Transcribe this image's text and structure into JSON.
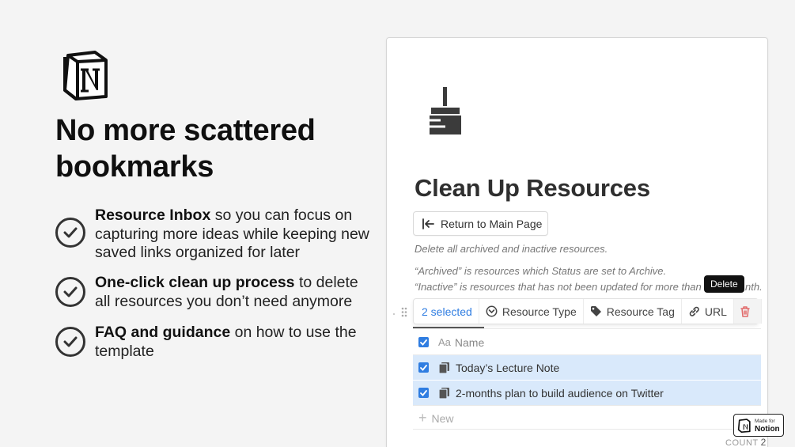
{
  "headline": "No more scattered bookmarks",
  "features": [
    {
      "bold": "Resource Inbox",
      "rest": " so you can focus on capturing more ideas while keeping new saved links organized for later"
    },
    {
      "bold": "One-click clean up process",
      "rest": " to delete all resources you don’t need anymore"
    },
    {
      "bold": "FAQ and guidance",
      "rest": " on how to use the template"
    }
  ],
  "page": {
    "title": "Clean Up Resources",
    "return_button": "Return to Main Page",
    "desc1": "Delete all archived and inactive resources.",
    "desc2": "“Archived” is resources which Status are set to Archive.",
    "desc3": "“Inactive” is resources that has not been updated for more than",
    "desc3_tail": "nth."
  },
  "toolbar": {
    "selected": "2 selected",
    "resource_type": "Resource Type",
    "resource_tag": "Resource Tag",
    "url": "URL",
    "tooltip": "Delete"
  },
  "table": {
    "header": {
      "aa": "Aa",
      "name": "Name"
    },
    "rows": [
      {
        "name": "Today’s Lecture Note"
      },
      {
        "name": "2-months plan to build audience on Twitter"
      }
    ],
    "new_label": "New",
    "count_label": "COUNT",
    "count_value": "2"
  },
  "badge": {
    "small": "Made for",
    "big": "Notion"
  },
  "colors": {
    "accent": "#2f7de1",
    "selected_row": "#d9e9fb",
    "trash": "#e16a6a"
  }
}
